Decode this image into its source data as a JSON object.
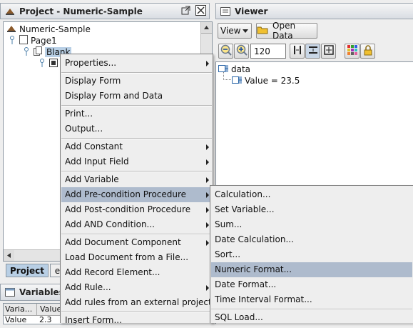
{
  "project_panel": {
    "title": "Project - Numeric-Sample",
    "tree": {
      "root": "Numeric-Sample",
      "page": "Page1",
      "form": "Blank"
    },
    "tabs": [
      "Project",
      "e"
    ]
  },
  "viewer_panel": {
    "title": "Viewer",
    "view_button": "View",
    "open_data_button": "Open Data",
    "zoom_value": "120 dpi",
    "tree": {
      "root": "data",
      "child": "Value = 23.5"
    }
  },
  "variables_panel": {
    "title": "Variables",
    "columns": [
      "Varia...",
      "Value"
    ],
    "row_partial": [
      "Value",
      "2.3"
    ]
  },
  "context_menu": {
    "items": [
      "Properties...",
      "Display Form",
      "Display Form and Data",
      "Print...",
      "Output...",
      "Add Constant",
      "Add Input Field",
      "Add Variable",
      "Add Pre-condition Procedure",
      "Add Post-condition Procedure",
      "Add AND Condition...",
      "Add Document Component",
      "Load Document from a File...",
      "Add Record Element...",
      "Add Rule...",
      "Add rules from an external project...",
      "Insert Form..."
    ]
  },
  "submenu": {
    "items": [
      "Calculation...",
      "Set Variable...",
      "Sum...",
      "Date Calculation...",
      "Sort...",
      "Numeric Format...",
      "Date Format...",
      "Time Interval Format...",
      "SQL Load..."
    ]
  },
  "colors": {
    "selection": "#aebbcd",
    "menu_bg": "#eeeeee",
    "tree_selected": "#b8cfe5"
  }
}
